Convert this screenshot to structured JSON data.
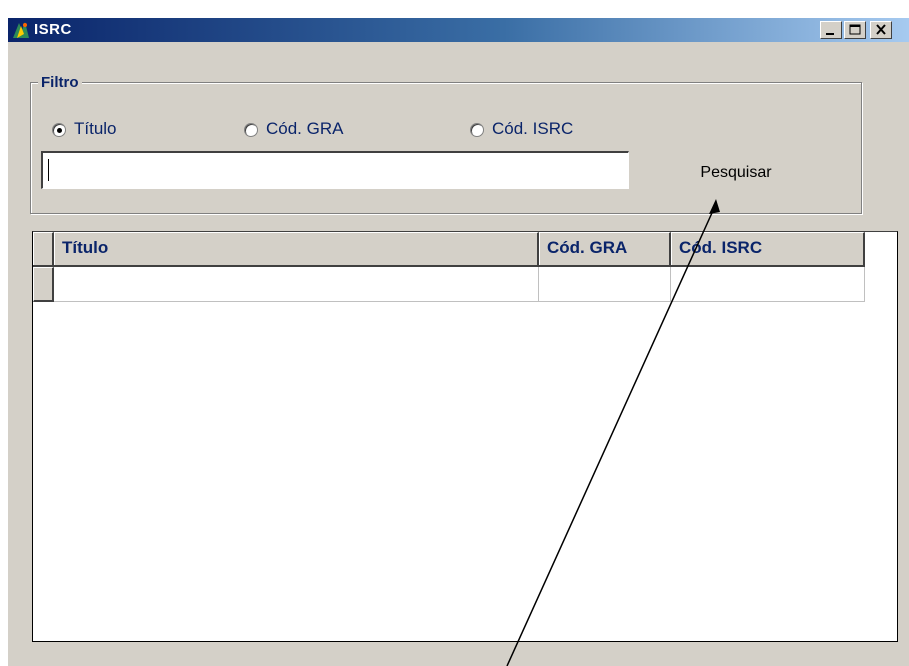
{
  "window": {
    "title": "ISRC",
    "icon": "app-icon",
    "controls": [
      "minimize-icon",
      "maximize-icon",
      "close-icon"
    ]
  },
  "filter": {
    "group_label": "Filtro",
    "options": [
      {
        "label": "Título",
        "selected": true
      },
      {
        "label": "Cód. GRA",
        "selected": false
      },
      {
        "label": "Cód. ISRC",
        "selected": false
      }
    ],
    "search_value": "",
    "search_button": "Pesquisar"
  },
  "grid": {
    "columns": [
      "Título",
      "Cód. GRA",
      "Cód. ISRC"
    ],
    "rows": [
      [
        "",
        "",
        ""
      ]
    ]
  },
  "colors": {
    "title_bar_start": "#0a246a",
    "title_bar_end": "#a6caf0",
    "window_face": "#d4d0c8",
    "label_text": "#0a246a"
  }
}
